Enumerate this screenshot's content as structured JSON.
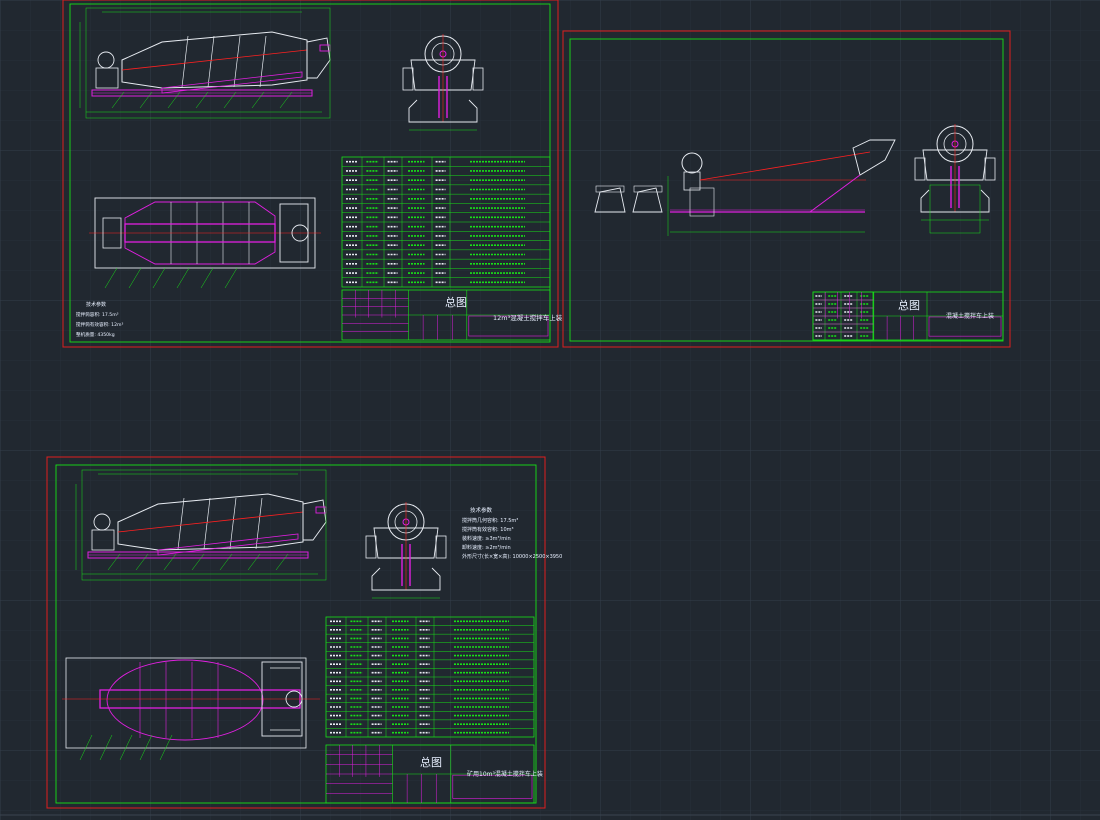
{
  "viewport": {
    "background": "#212830",
    "grid_minor": "#28303a",
    "grid_major": "#333d48"
  },
  "colors": {
    "sheet_border": "#e01e1e",
    "frame": "#18e018",
    "drawing": "#e8ecf2",
    "centerline": "#ff2020",
    "chassis": "#e020e0",
    "dims": "#18e018",
    "title_ink": "#e8f0ff"
  },
  "sheets": [
    {
      "name": "sheet-1",
      "title_block": {
        "main_text": "总图",
        "sub_text": "12m³混凝土搅拌车上装"
      }
    },
    {
      "name": "sheet-2",
      "title_block": {
        "main_text": "总图",
        "sub_text": "混凝土搅拌车上装"
      }
    },
    {
      "name": "sheet-3",
      "title_block": {
        "main_text": "总图",
        "sub_text": "矿用10m³混凝土搅拌车上装"
      },
      "spec_notes": {
        "heading": "技术参数",
        "lines": [
          "搅拌筒几何容积: 17.5m³",
          "搅拌筒有效容积: 10m³",
          "装料速度: ≥3m³/min",
          "卸料速度: ≥2m³/min",
          "外形尺寸(长×宽×高): 10000×2500×3950"
        ]
      }
    },
    {
      "name": "sheet-1-notes",
      "spec_notes": {
        "heading": "技术参数",
        "lines": [
          "搅拌筒容积: 17.5m³",
          "搅拌筒有效容积: 12m³",
          "整机质量: 4350kg"
        ]
      }
    }
  ],
  "status_bar": {
    "text": ""
  }
}
